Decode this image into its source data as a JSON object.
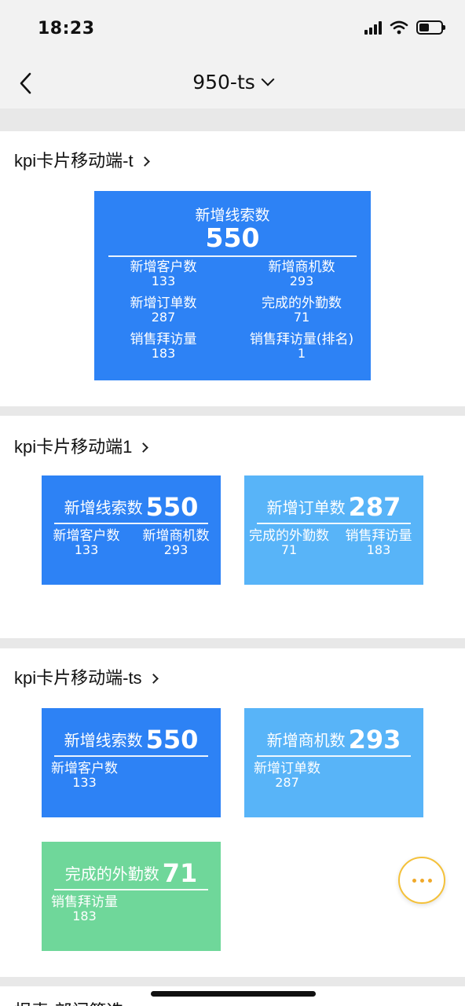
{
  "status_bar": {
    "time": "18:23"
  },
  "nav": {
    "title": "950-ts"
  },
  "section1": {
    "title": "kpi卡片移动端-t",
    "card": {
      "main_label": "新增线索数",
      "main_value": "550",
      "items": [
        {
          "label": "新增客户数",
          "value": "133"
        },
        {
          "label": "新增商机数",
          "value": "293"
        },
        {
          "label": "新增订单数",
          "value": "287"
        },
        {
          "label": "完成的外勤数",
          "value": "71"
        },
        {
          "label": "销售拜访量",
          "value": "183"
        },
        {
          "label": "销售拜访量(排名)",
          "value": "1"
        }
      ]
    }
  },
  "section2": {
    "title": "kpi卡片移动端1",
    "cards": [
      {
        "main_label": "新增线索数",
        "main_value": "550",
        "items": [
          {
            "label": "新增客户数",
            "value": "133"
          },
          {
            "label": "新增商机数",
            "value": "293"
          }
        ]
      },
      {
        "main_label": "新增订单数",
        "main_value": "287",
        "items": [
          {
            "label": "完成的外勤数",
            "value": "71"
          },
          {
            "label": "销售拜访量",
            "value": "183"
          }
        ]
      }
    ]
  },
  "section3": {
    "title": "kpi卡片移动端-ts",
    "cards": [
      {
        "main_label": "新增线索数",
        "main_value": "550",
        "item": {
          "label": "新增客户数",
          "value": "133"
        }
      },
      {
        "main_label": "新增商机数",
        "main_value": "293",
        "item": {
          "label": "新增订单数",
          "value": "287"
        }
      },
      {
        "main_label": "完成的外勤数",
        "main_value": "71",
        "item": {
          "label": "销售拜访量",
          "value": "183"
        }
      }
    ]
  },
  "section4": {
    "title": "报表-部门筛选"
  },
  "colors": {
    "blue": "#2d82f5",
    "light_blue": "#58b4f8",
    "green": "#6fd79a",
    "fab_border": "#f4c13a"
  }
}
